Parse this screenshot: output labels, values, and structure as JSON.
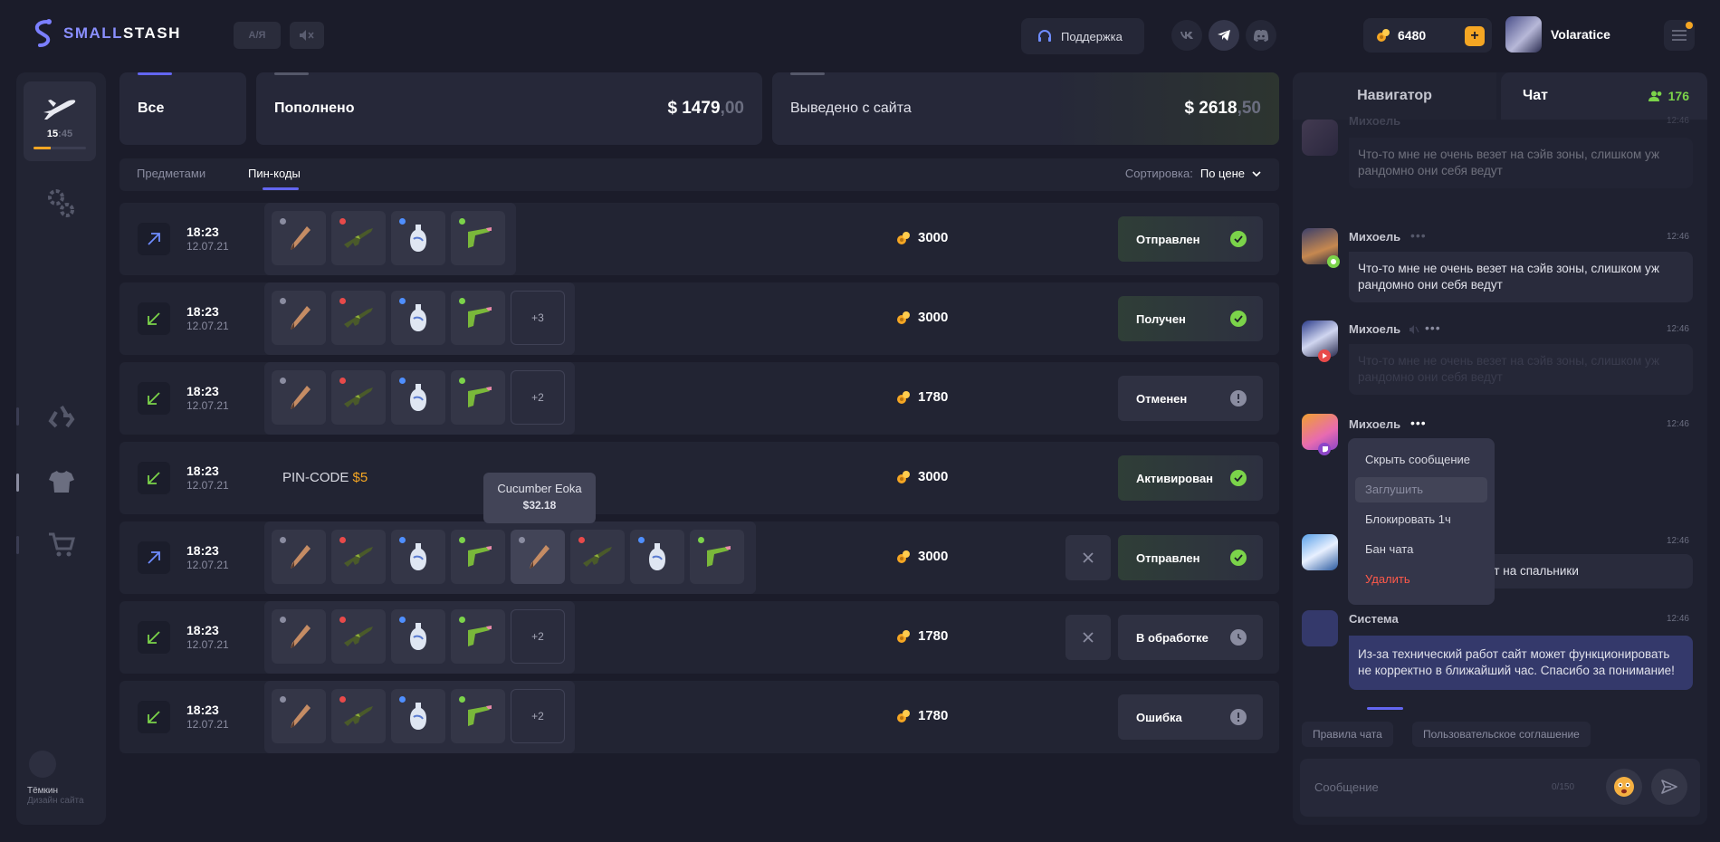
{
  "header": {
    "logo_part1": "SMALL",
    "logo_part2": "STASH",
    "lang_label": "A/Я",
    "support_label": "Поддержка",
    "balance": "6480",
    "plus_label": "+",
    "username": "Volaratice"
  },
  "sidebar": {
    "level_current": "15",
    "level_total": ":45",
    "level_progress": 0.33,
    "user_name": "Тёмкин",
    "user_role": "Дизайн сайта"
  },
  "stats": {
    "all_label": "Все",
    "deposited_label": "Пополнено",
    "deposited_int": "$ 1479",
    "deposited_cents": ",00",
    "withdrawn_label": "Выведено с сайта",
    "withdrawn_int": "$ 2618",
    "withdrawn_cents": ",50"
  },
  "tabs": {
    "items_label": "Предметами",
    "pins_label": "Пин-коды",
    "sort_label": "Сортировка:",
    "sort_value": "По цене"
  },
  "rows": [
    {
      "time": "18:23",
      "date": "12.07.21",
      "price": "3000",
      "status": "Отправлен",
      "more": ""
    },
    {
      "time": "18:23",
      "date": "12.07.21",
      "price": "3000",
      "status": "Получен",
      "more": "+3"
    },
    {
      "time": "18:23",
      "date": "12.07.21",
      "price": "1780",
      "status": "Отменен",
      "more": "+2"
    },
    {
      "time": "18:23",
      "date": "12.07.21",
      "price": "3000",
      "status": "Активирован",
      "pin_label": "PIN-CODE",
      "pin_value": "$5"
    },
    {
      "time": "18:23",
      "date": "12.07.21",
      "price": "3000",
      "status": "Отправлен",
      "more": ""
    },
    {
      "time": "18:23",
      "date": "12.07.21",
      "price": "1780",
      "status": "В обработке",
      "more": "+2"
    },
    {
      "time": "18:23",
      "date": "12.07.21",
      "price": "1780",
      "status": "Ошибка",
      "more": "+2"
    }
  ],
  "tooltip": {
    "name": "Cucumber Eoka",
    "price": "$32.18"
  },
  "chat": {
    "nav_tab": "Навигатор",
    "chat_tab": "Чат",
    "online": "176",
    "messages": [
      {
        "name": "Михоель",
        "time": "12:46",
        "text": "Что-то мне не очень везет на сэйв зоны, слишком уж рандомно они себя ведут"
      },
      {
        "name": "Михоель",
        "time": "12:46",
        "text": "Что-то мне не очень везет на сэйв зоны, слишком уж рандомно они себя ведут"
      },
      {
        "name": "Михоель",
        "time": "12:46",
        "text": "Что-то мне не очень везет на сэйв зоны, слишком уж рандомно они себя ведут"
      },
      {
        "name": "Михоель",
        "time": "12:46"
      },
      {
        "time": "12:46",
        "text": "езет на спальники"
      },
      {
        "name": "Система",
        "time": "12:46",
        "text": "Из-за технический работ сайт может функционировать не корректно в ближайший час. Спасибо за понимание!"
      }
    ],
    "context_menu": [
      "Скрыть сообщение",
      "Заглушить",
      "Блокировать 1ч",
      "Бан чата",
      "Удалить"
    ],
    "rules_label": "Правила чата",
    "agreement_label": "Пользовательское соглашение",
    "input_placeholder": "Сообщение",
    "char_count": "0/150"
  },
  "colors": {
    "accent": "#6366f1",
    "gold": "#f5a623",
    "success": "#7bd34a",
    "danger": "#e84a4a",
    "bg": "#1b1c2a"
  }
}
